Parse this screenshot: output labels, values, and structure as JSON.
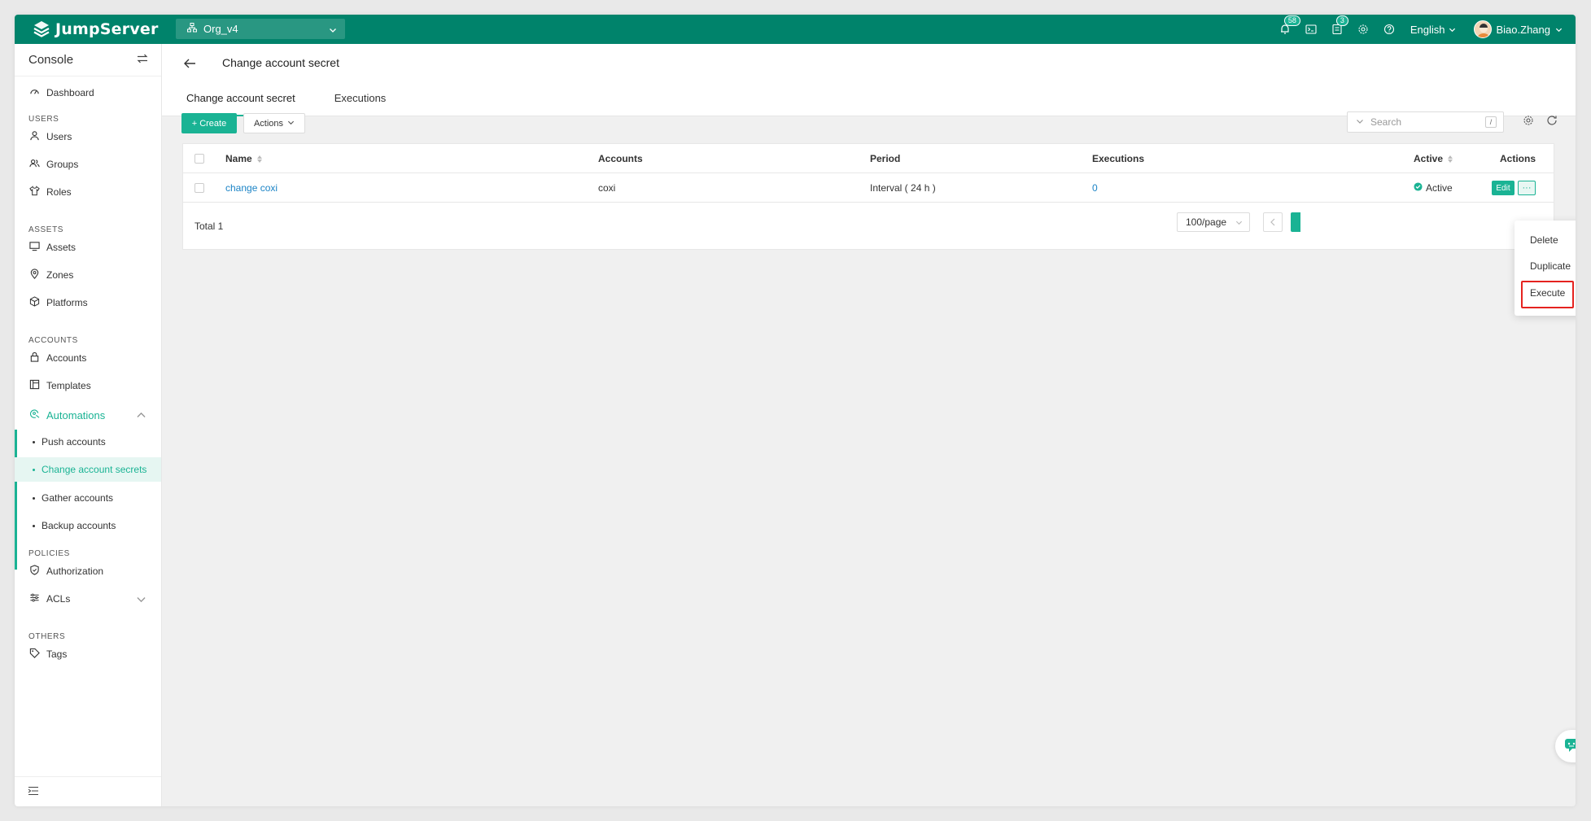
{
  "brand": {
    "name": "JumpServer"
  },
  "topbar": {
    "org": "Org_v4",
    "notifications_count": "58",
    "tickets_count": "3",
    "language": "English",
    "user": "Biao.Zhang",
    "accent_color": "#00836b"
  },
  "sidebar": {
    "title": "Console",
    "items": {
      "dashboard": "Dashboard",
      "users_group": "USERS",
      "users": "Users",
      "groups": "Groups",
      "roles": "Roles",
      "assets_group": "ASSETS",
      "assets": "Assets",
      "zones": "Zones",
      "platforms": "Platforms",
      "accounts_group": "ACCOUNTS",
      "accounts": "Accounts",
      "templates": "Templates",
      "automations": "Automations",
      "push_accounts": "Push accounts",
      "change_account_secrets": "Change account secrets",
      "gather_accounts": "Gather accounts",
      "backup_accounts": "Backup accounts",
      "policies_group": "POLICIES",
      "authorization": "Authorization",
      "acls": "ACLs",
      "others_group": "OTHERS",
      "tags": "Tags"
    }
  },
  "page": {
    "title": "Change account secret",
    "tabs": [
      "Change account secret",
      "Executions"
    ]
  },
  "toolbar": {
    "create_label": "Create",
    "actions_label": "Actions",
    "search_placeholder": "Search",
    "search_shortcut": "/"
  },
  "table": {
    "columns": {
      "name": "Name",
      "accounts": "Accounts",
      "period": "Period",
      "executions": "Executions",
      "active": "Active",
      "actions": "Actions"
    },
    "rows": [
      {
        "name": "change coxi",
        "accounts": "coxi",
        "period": "Interval ( 24 h )",
        "executions": "0",
        "active": "Active",
        "edit": "Edit",
        "more": "···"
      }
    ],
    "total": "Total 1",
    "page_size": "100/page"
  },
  "dropdown": {
    "items": [
      "Delete",
      "Duplicate",
      "Execute"
    ],
    "highlighted": "Execute"
  }
}
